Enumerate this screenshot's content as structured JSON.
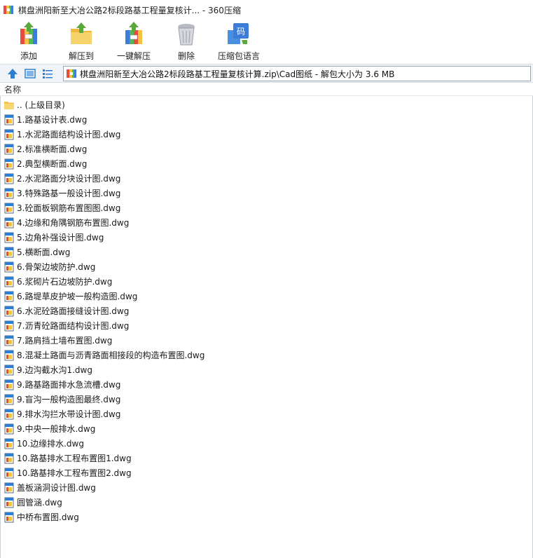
{
  "window": {
    "title": "棋盘洲阳新至大冶公路2标段路基工程量复核计... - 360压缩",
    "app_icon": "archive-app-icon"
  },
  "toolbar": {
    "add_label": "添加",
    "extract_label": "解压到",
    "oneclick_label": "一键解压",
    "delete_label": "删除",
    "language_label": "压缩包语言"
  },
  "nav": {
    "address": "棋盘洲阳新至大冶公路2标段路基工程量复核计算.zip\\Cad图纸 - 解包大小为 3.6 MB"
  },
  "columns": {
    "name": "名称"
  },
  "files": [
    {
      "name": ".. (上级目录)",
      "type": "folder"
    },
    {
      "name": "1.路基设计表.dwg",
      "type": "dwg"
    },
    {
      "name": "1.水泥路面结构设计图.dwg",
      "type": "dwg"
    },
    {
      "name": "2.标准横断面.dwg",
      "type": "dwg"
    },
    {
      "name": "2.典型横断面.dwg",
      "type": "dwg"
    },
    {
      "name": "2.水泥路面分块设计图.dwg",
      "type": "dwg"
    },
    {
      "name": "3.特殊路基一般设计图.dwg",
      "type": "dwg"
    },
    {
      "name": "3.砼面板钢筋布置图图.dwg",
      "type": "dwg"
    },
    {
      "name": "4.边缘和角隅钢筋布置图.dwg",
      "type": "dwg"
    },
    {
      "name": "5.边角补强设计图.dwg",
      "type": "dwg"
    },
    {
      "name": "5.横断面.dwg",
      "type": "dwg"
    },
    {
      "name": "6.骨架边坡防护.dwg",
      "type": "dwg"
    },
    {
      "name": "6.浆砌片石边坡防护.dwg",
      "type": "dwg"
    },
    {
      "name": "6.路堤草皮护坡一般构造图.dwg",
      "type": "dwg"
    },
    {
      "name": "6.水泥砼路面接缝设计图.dwg",
      "type": "dwg"
    },
    {
      "name": "7.沥青砼路面结构设计图.dwg",
      "type": "dwg"
    },
    {
      "name": "7.路肩挡土墙布置图.dwg",
      "type": "dwg"
    },
    {
      "name": "8.混凝土路面与沥青路面相接段的构造布置图.dwg",
      "type": "dwg"
    },
    {
      "name": "9.边沟截水沟1.dwg",
      "type": "dwg"
    },
    {
      "name": "9.路基路面排水急流槽.dwg",
      "type": "dwg"
    },
    {
      "name": "9.盲沟一般构造图最终.dwg",
      "type": "dwg"
    },
    {
      "name": "9.排水沟拦水带设计图.dwg",
      "type": "dwg"
    },
    {
      "name": "9.中央一般排水.dwg",
      "type": "dwg"
    },
    {
      "name": "10.边缘排水.dwg",
      "type": "dwg"
    },
    {
      "name": "10.路基排水工程布置图1.dwg",
      "type": "dwg"
    },
    {
      "name": "10.路基排水工程布置图2.dwg",
      "type": "dwg"
    },
    {
      "name": "盖板涵洞设计图.dwg",
      "type": "dwg"
    },
    {
      "name": "圆管涵.dwg",
      "type": "dwg"
    },
    {
      "name": "中桥布置图.dwg",
      "type": "dwg"
    }
  ],
  "colors": {
    "nav_bg": "#f0f3f7",
    "accent_blue": "#2a7fd4",
    "folder_yellow": "#f7d774"
  }
}
